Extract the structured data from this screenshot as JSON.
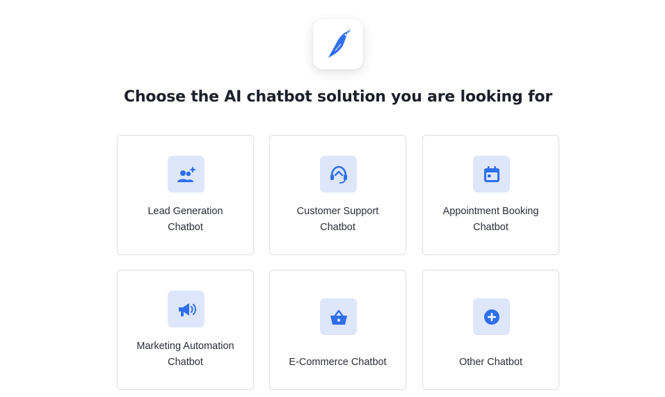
{
  "page": {
    "title": "Choose the AI chatbot solution you are looking for"
  },
  "logo": {
    "icon": "bird-logo-icon",
    "color": "#2f6fec"
  },
  "accent_color": "#2f6fec",
  "options": [
    {
      "icon": "users-sparkle-icon",
      "line1": "Lead Generation",
      "line2": "Chatbot"
    },
    {
      "icon": "headset-icon",
      "line1": "Customer Support",
      "line2": "Chatbot"
    },
    {
      "icon": "calendar-icon",
      "line1": "Appointment Booking",
      "line2": "Chatbot"
    },
    {
      "icon": "megaphone-icon",
      "line1": "Marketing Automation",
      "line2": "Chatbot"
    },
    {
      "icon": "shopping-basket-icon",
      "line1": "E-Commerce Chatbot"
    },
    {
      "icon": "plus-circle-icon",
      "line1": "Other Chatbot"
    }
  ]
}
